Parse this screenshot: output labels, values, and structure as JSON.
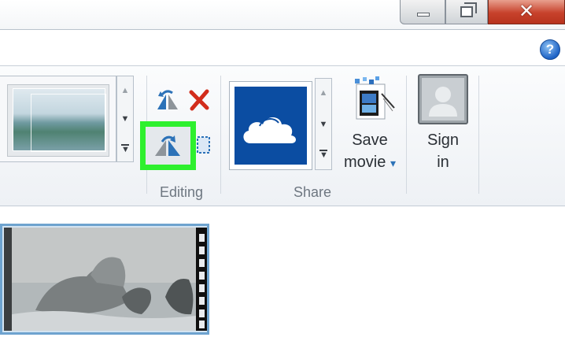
{
  "window": {
    "minimize_glyph": "",
    "maximize_glyph": "",
    "close_glyph": "✕"
  },
  "help": {
    "glyph": "?"
  },
  "ribbon": {
    "groups": {
      "editing": {
        "label": "Editing"
      },
      "share": {
        "label": "Share"
      }
    },
    "share": {
      "save_movie": {
        "line1": "Save",
        "line2": "movie",
        "arrow": "▾"
      },
      "sign_in": {
        "line1": "Sign",
        "line2": "in"
      }
    },
    "gallery_arrows": {
      "up": "▲",
      "down": "▼",
      "more": "▼"
    }
  },
  "colors": {
    "highlight": "#2ef02e",
    "onedrive_tile": "#0b4da2",
    "close_button": "#c7412b",
    "clip_border": "#6ea3cf"
  },
  "icons": [
    "rotate-left-icon",
    "remove-icon",
    "rotate-right-icon",
    "select-all-icon",
    "onedrive-cloud-icon",
    "save-movie-icon",
    "sign-in-user-icon",
    "help-icon"
  ]
}
